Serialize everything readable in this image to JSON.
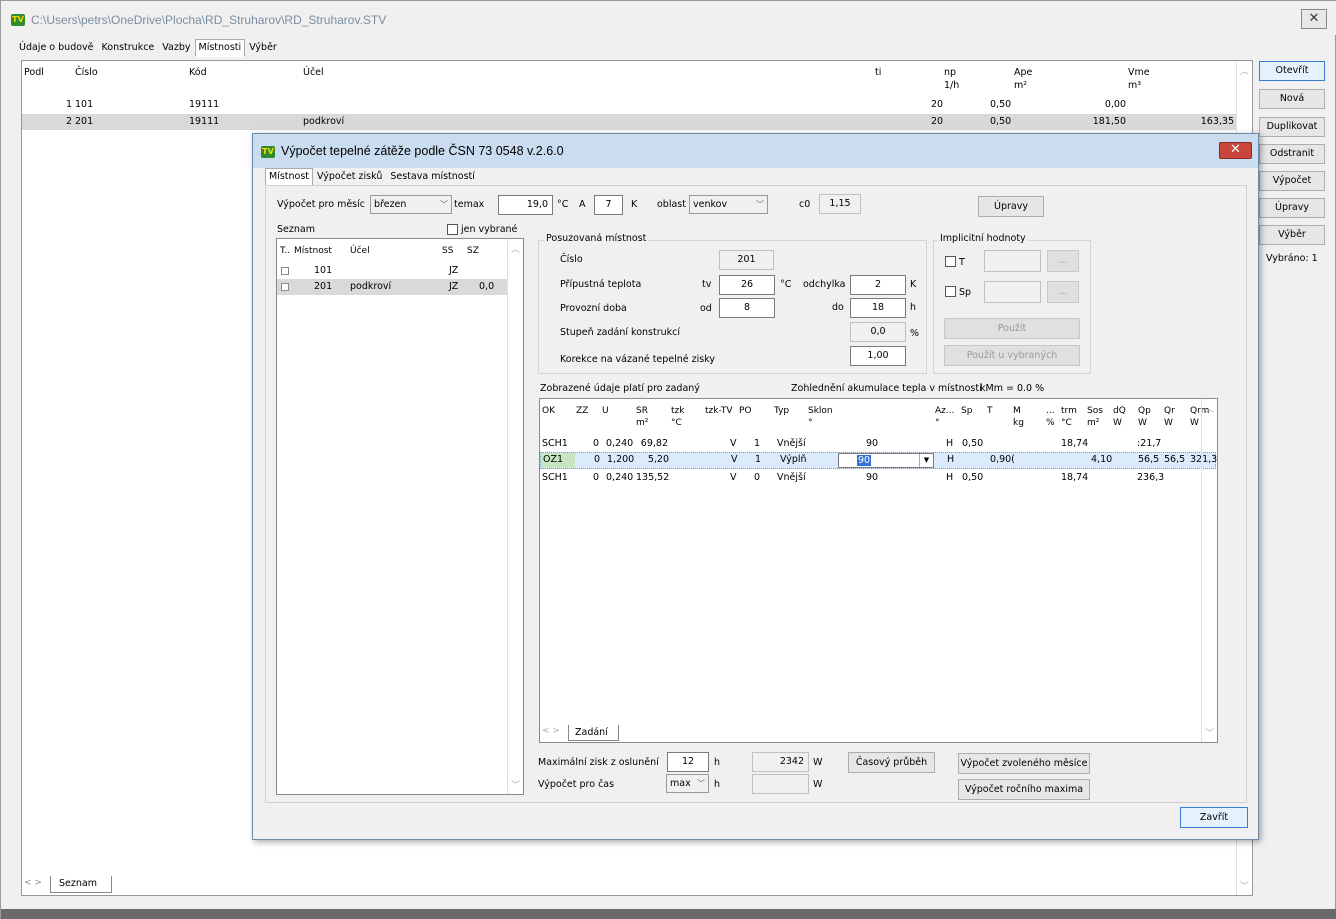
{
  "window": {
    "title": "C:\\Users\\petrs\\OneDrive\\Plocha\\RD_Struharov\\RD_Struharov.STV",
    "icon_text": "TV",
    "close_label": "✕"
  },
  "tabs": [
    "Údaje o budově",
    "Konstrukce",
    "Vazby",
    "Místnosti",
    "Výběr"
  ],
  "main_table": {
    "headers": {
      "podl": "Podl",
      "cislo": "Číslo",
      "kod": "Kód",
      "ucel": "Účel",
      "ti": "ti",
      "np": "np",
      "np_unit": "1/h",
      "ape": "Ape",
      "ape_unit": "m²",
      "vme": "Vme",
      "vme_unit": "m³"
    },
    "rows": [
      {
        "podl": "1",
        "cislo": "101",
        "kod": "19111",
        "ucel": "",
        "ti": "20",
        "np": "0,50",
        "ape": "0,00",
        "vme": ""
      },
      {
        "podl": "2",
        "cislo": "201",
        "kod": "19111",
        "ucel": "podkroví",
        "ti": "20",
        "np": "0,50",
        "ape": "181,50",
        "vme": "163,35"
      }
    ],
    "bottom_tab": "Seznam"
  },
  "side_buttons": [
    "Otevřít",
    "Nová",
    "Duplikovat",
    "Odstranit",
    "Výpočet",
    "Úpravy",
    "Výběr"
  ],
  "selected_count": "Vybráno: 1",
  "dialog": {
    "title": "Výpočet tepelné zátěže podle ČSN 73 0548 v.2.6.0",
    "close_label": "✕",
    "tabs": [
      "Místnost",
      "Výpočet zisků",
      "Sestava místností"
    ],
    "month_label": "Výpočet pro měsíc",
    "month_value": "březen",
    "temax_label": "temax",
    "temax_value": "19,0",
    "temax_unit": "°C",
    "a_label": "A",
    "a_value": "7",
    "a_unit": "K",
    "oblast_label": "oblast",
    "oblast_value": "venkov",
    "c0_label": "c0",
    "c0_value": "1,15",
    "upravy_button": "Úpravy",
    "seznam_label": "Seznam",
    "jen_vybrane_label": "jen vybrané",
    "list_headers": {
      "t": "T..",
      "mistnost": "Místnost",
      "ucel": "Účel",
      "ss": "SS",
      "sz": "SZ"
    },
    "list_rows": [
      {
        "mistnost": "101",
        "ucel": "",
        "ss": "JZ",
        "sz": ""
      },
      {
        "mistnost": "201",
        "ucel": "podkroví",
        "ss": "JZ",
        "sz": "0,0"
      }
    ],
    "posuzovana": {
      "group_label": "Posuzovaná místnost",
      "cislo_label": "Číslo",
      "cislo_value": "201",
      "pripustna_label": "Přípustná teplota",
      "tv_label": "tv",
      "tv_value": "26",
      "tv_unit": "°C",
      "odchylka_label": "odchylka",
      "odchylka_value": "2",
      "odchylka_unit": "K",
      "provozni_label": "Provozní doba",
      "od_label": "od",
      "od_value": "8",
      "do_label": "do",
      "do_value": "18",
      "do_unit": "h",
      "stupen_label": "Stupeň zadání konstrukcí",
      "stupen_value": "0,0",
      "stupen_unit": "%",
      "korekce_label": "Korekce na vázané tepelné zisky",
      "korekce_value": "1,00"
    },
    "implicitni": {
      "group_label": "Implicitní hodnoty",
      "t_label": "T",
      "sp_label": "Sp",
      "ellipsis": "...",
      "pouzit": "Použít",
      "pouzit_vybranych": "Použít u vybraných"
    },
    "zobrazene_label": "Zobrazené údaje platí pro zadaný",
    "zohledneni_label": "Zohlednění akumulace tepla v místnosti",
    "kmm_label": "kMm = 0.0 %",
    "grid_headers": [
      {
        "key": "ok",
        "l1": "OK",
        "l2": ""
      },
      {
        "key": "zz",
        "l1": "ZZ",
        "l2": ""
      },
      {
        "key": "u",
        "l1": "U",
        "l2": ""
      },
      {
        "key": "sr",
        "l1": "SR",
        "l2": "m²"
      },
      {
        "key": "tzk",
        "l1": "tzk",
        "l2": "°C"
      },
      {
        "key": "tzktv",
        "l1": "tzk-TV",
        "l2": ""
      },
      {
        "key": "po",
        "l1": "PO",
        "l2": ""
      },
      {
        "key": "typ",
        "l1": "Typ",
        "l2": ""
      },
      {
        "key": "sklon",
        "l1": "Sklon",
        "l2": "°"
      },
      {
        "key": "az",
        "l1": "Az...",
        "l2": "°"
      },
      {
        "key": "sp",
        "l1": "Sp",
        "l2": ""
      },
      {
        "key": "t",
        "l1": "T",
        "l2": ""
      },
      {
        "key": "m",
        "l1": "M",
        "l2": "kg"
      },
      {
        "key": "dots",
        "l1": "...",
        "l2": "%"
      },
      {
        "key": "trm",
        "l1": "trm",
        "l2": "°C"
      },
      {
        "key": "sos",
        "l1": "Sos",
        "l2": "m²"
      },
      {
        "key": "dq",
        "l1": "dQ",
        "l2": "W"
      },
      {
        "key": "qp",
        "l1": "Qp",
        "l2": "W"
      },
      {
        "key": "qr",
        "l1": "Qr",
        "l2": "W"
      },
      {
        "key": "qrm",
        "l1": "Qrm",
        "l2": "W"
      }
    ],
    "grid_rows": [
      {
        "ok": "SCH1",
        "zz": "0",
        "u": "0,240",
        "sr": "69,82",
        "tzktv": "V",
        "po": "1",
        "typ": "Vnější",
        "sklon": "90",
        "az": "H",
        "sp": "0,50",
        "t": "",
        "trm": "18,74",
        "sos": "",
        "qp": ":21,7",
        "qr": "",
        "qrm": ""
      },
      {
        "ok": "OZ1",
        "zz": "0",
        "u": "1,200",
        "sr": "5,20",
        "tzktv": "V",
        "po": "1",
        "typ": "Výplň",
        "sklon": "90",
        "az": "H",
        "sp": "",
        "t": "0,90(",
        "trm": "",
        "sos": "4,10",
        "qp": "56,5",
        "qr": "56,5",
        "qrm": "321,3"
      },
      {
        "ok": "SCH1",
        "zz": "0",
        "u": "0,240",
        "sr": "135,52",
        "tzktv": "V",
        "po": "0",
        "typ": "Vnější",
        "sklon": "90",
        "az": "H",
        "sp": "0,50",
        "t": "",
        "trm": "18,74",
        "sos": "",
        "qp": "236,3",
        "qr": "",
        "qrm": ""
      }
    ],
    "grid_bottom_tab": "Zadání",
    "max_zisk_label": "Maximální zisk z oslunění",
    "max_zisk_value": "12",
    "max_zisk_unit": "h",
    "max_w_value": "2342",
    "w_unit": "W",
    "casovy_button": "Časový průběh",
    "vypocet_mesice_button": "Výpočet zvoleného měsíce",
    "vypocet_cas_label": "Výpočet pro čas",
    "cas_value": "max",
    "cas_unit": "h",
    "cas_w_value": "",
    "rocni_button": "Výpočet ročního maxima",
    "zavrit_button": "Zavřít"
  }
}
